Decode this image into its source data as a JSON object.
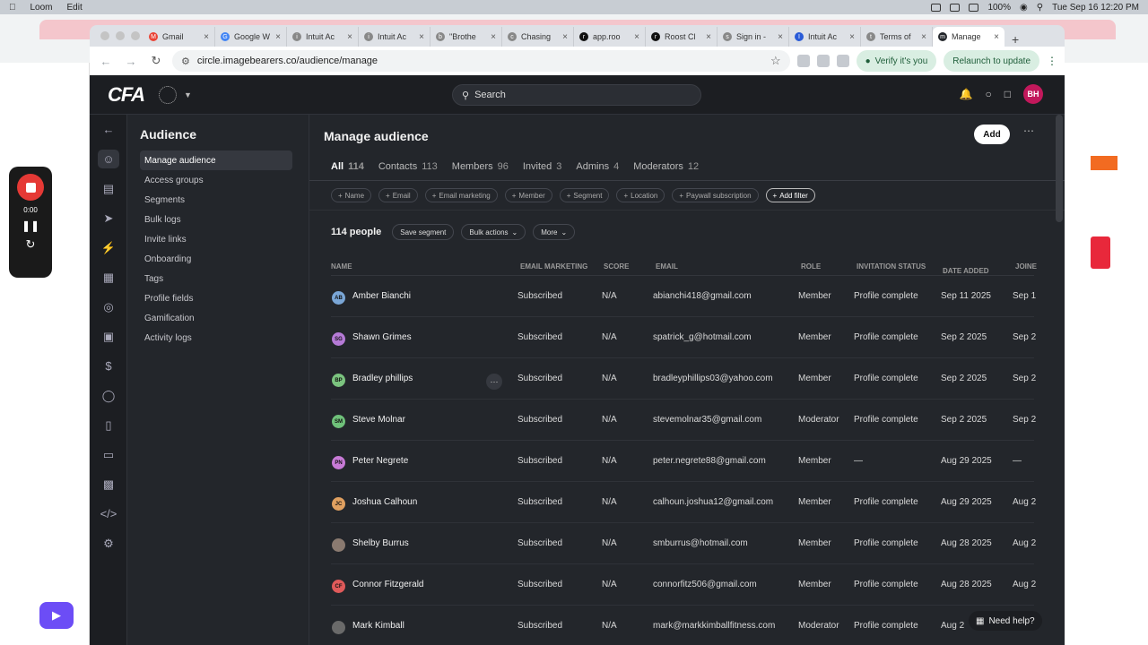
{
  "macos": {
    "menu": [
      "Loom",
      "Edit"
    ],
    "battery": "100%",
    "datetime": "Tue Sep 16  12:20 PM"
  },
  "browser": {
    "tabs": [
      {
        "label": "Gmail",
        "fav": "M"
      },
      {
        "label": "Google W",
        "fav": "G"
      },
      {
        "label": "Intuit Ac",
        "fav": "i"
      },
      {
        "label": "Intuit Ac",
        "fav": "i"
      },
      {
        "label": "\"Brothe",
        "fav": "b"
      },
      {
        "label": "Chasing",
        "fav": "c"
      },
      {
        "label": "app.roo",
        "fav": "r"
      },
      {
        "label": "Roost Cl",
        "fav": "r"
      },
      {
        "label": "Sign in -",
        "fav": "s"
      },
      {
        "label": "Intuit Ac",
        "fav": "I"
      },
      {
        "label": "Terms of",
        "fav": "t"
      },
      {
        "label": "Manage",
        "fav": "m",
        "active": true
      }
    ],
    "url": "circle.imagebearers.co/audience/manage",
    "verify_label": "Verify it's you",
    "relaunch_label": "Relaunch to update"
  },
  "app": {
    "logo": "CFA",
    "search_placeholder": "Search",
    "user_initials": "BH",
    "sidebar": {
      "title": "Audience",
      "items": [
        {
          "label": "Manage audience",
          "selected": true
        },
        {
          "label": "Access groups"
        },
        {
          "label": "Segments"
        },
        {
          "label": "Bulk logs"
        },
        {
          "label": "Invite links"
        },
        {
          "label": "Onboarding"
        },
        {
          "label": "Tags"
        },
        {
          "label": "Profile fields"
        },
        {
          "label": "Gamification"
        },
        {
          "label": "Activity logs"
        }
      ]
    },
    "page_title": "Manage audience",
    "add_label": "Add",
    "filter_tabs": [
      {
        "label": "All",
        "count": "114",
        "selected": true
      },
      {
        "label": "Contacts",
        "count": "113"
      },
      {
        "label": "Members",
        "count": "96"
      },
      {
        "label": "Invited",
        "count": "3"
      },
      {
        "label": "Admins",
        "count": "4"
      },
      {
        "label": "Moderators",
        "count": "12"
      }
    ],
    "filter_chips": [
      "Name",
      "Email",
      "Email marketing",
      "Member",
      "Segment",
      "Location",
      "Paywall subscription"
    ],
    "add_filter_label": "Add filter",
    "people_count": "114 people",
    "save_segment_label": "Save segment",
    "bulk_actions_label": "Bulk actions",
    "more_label": "More",
    "columns": [
      "NAME",
      "EMAIL MARKETING",
      "SCORE",
      "EMAIL",
      "ROLE",
      "INVITATION STATUS",
      "DATE ADDED",
      "JOINE"
    ],
    "rows": [
      {
        "initials": "AB",
        "color": "#7aa6d6",
        "name": "Amber Bianchi",
        "marketing": "Subscribed",
        "score": "N/A",
        "email": "abianchi418@gmail.com",
        "role": "Member",
        "status": "Profile complete",
        "date_added": "Sep 11 2025",
        "joined": "Sep 1"
      },
      {
        "initials": "SG",
        "color": "#b57ad6",
        "name": "Shawn Grimes",
        "marketing": "Subscribed",
        "score": "N/A",
        "email": "spatrick_g@hotmail.com",
        "role": "Member",
        "status": "Profile complete",
        "date_added": "Sep 2 2025",
        "joined": "Sep 2"
      },
      {
        "initials": "BP",
        "color": "#7bc47f",
        "name": "Bradley phillips",
        "marketing": "Subscribed",
        "score": "N/A",
        "email": "bradleyphillips03@yahoo.com",
        "role": "Member",
        "status": "Profile complete",
        "date_added": "Sep 2 2025",
        "joined": "Sep 2",
        "hover": true
      },
      {
        "initials": "SM",
        "color": "#6fc17a",
        "name": "Steve Molnar",
        "marketing": "Subscribed",
        "score": "N/A",
        "email": "stevemolnar35@gmail.com",
        "role": "Moderator",
        "status": "Profile complete",
        "date_added": "Sep 2 2025",
        "joined": "Sep 2"
      },
      {
        "initials": "PN",
        "color": "#c77ad6",
        "name": "Peter Negrete",
        "marketing": "Subscribed",
        "score": "N/A",
        "email": "peter.negrete88@gmail.com",
        "role": "Member",
        "status": "—",
        "date_added": "Aug 29 2025",
        "joined": "—"
      },
      {
        "initials": "JC",
        "color": "#e0a060",
        "name": "Joshua Calhoun",
        "marketing": "Subscribed",
        "score": "N/A",
        "email": "calhoun.joshua12@gmail.com",
        "role": "Member",
        "status": "Profile complete",
        "date_added": "Aug 29 2025",
        "joined": "Aug 2"
      },
      {
        "initials": "",
        "color": "#8a7a70",
        "name": "Shelby Burrus",
        "marketing": "Subscribed",
        "score": "N/A",
        "email": "smburrus@hotmail.com",
        "role": "Member",
        "status": "Profile complete",
        "date_added": "Aug 28 2025",
        "joined": "Aug 2"
      },
      {
        "initials": "CF",
        "color": "#e05a5a",
        "name": "Connor Fitzgerald",
        "marketing": "Subscribed",
        "score": "N/A",
        "email": "connorfitz506@gmail.com",
        "role": "Member",
        "status": "Profile complete",
        "date_added": "Aug 28 2025",
        "joined": "Aug 2"
      },
      {
        "initials": "",
        "color": "#6a6a6a",
        "name": "Mark Kimball",
        "marketing": "Subscribed",
        "score": "N/A",
        "email": "mark@markkimballfitness.com",
        "role": "Moderator",
        "status": "Profile complete",
        "date_added": "Aug 2",
        "joined": ""
      }
    ],
    "help_label": "Need help?"
  },
  "recorder": {
    "time": "0:00"
  }
}
